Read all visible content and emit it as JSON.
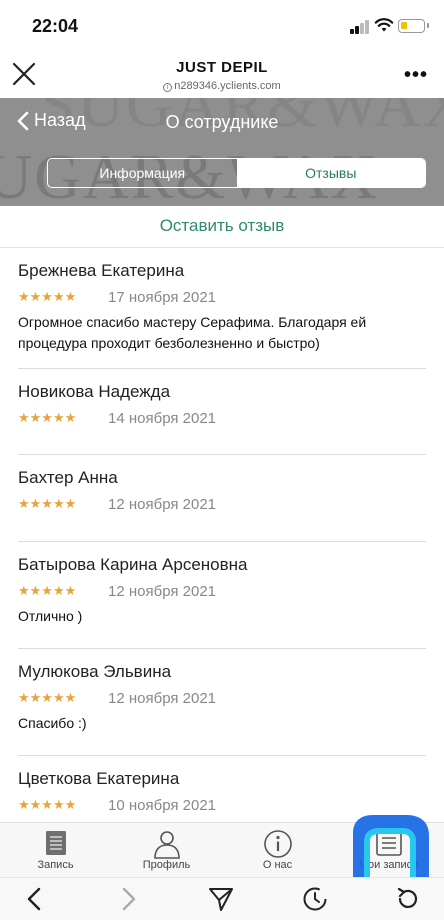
{
  "status": {
    "time": "22:04"
  },
  "browser": {
    "title": "JUST DEPIL",
    "url": "n289346.yclients.com"
  },
  "header": {
    "back_label": "Назад",
    "title": "О сотруднике",
    "tabs": [
      {
        "label": "Информация",
        "active": false
      },
      {
        "label": "Отзывы",
        "active": true
      }
    ]
  },
  "leave_review_label": "Оставить отзыв",
  "reviews": [
    {
      "name": "Брежнева Екатерина",
      "stars": "★★★★★",
      "rating": 5,
      "date": "17 ноября 2021",
      "text": "Огромное спасибо мастеру Серафима. Благодаря ей процедура проходит безболезненно и быстро)"
    },
    {
      "name": "Новикова Надежда",
      "stars": "★★★★★",
      "rating": 5,
      "date": "14 ноября 2021",
      "text": ""
    },
    {
      "name": "Бахтер Анна",
      "stars": "★★★★★",
      "rating": 5,
      "date": "12 ноября 2021",
      "text": ""
    },
    {
      "name": "Батырова Карина Арсеновна",
      "stars": "★★★★★",
      "rating": 5,
      "date": "12 ноября 2021",
      "text": "Отлично )"
    },
    {
      "name": "Мулюкова Эльвина",
      "stars": "★★★★★",
      "rating": 5,
      "date": "12 ноября 2021",
      "text": "Спасибо :)"
    },
    {
      "name": "Цветкова Екатерина",
      "stars": "★★★★★",
      "rating": 5,
      "date": "10 ноября 2021",
      "text": ""
    }
  ],
  "tabbar": {
    "items": [
      {
        "label": "Запись",
        "icon": "document-icon"
      },
      {
        "label": "Профиль",
        "icon": "person-icon"
      },
      {
        "label": "О нас",
        "icon": "info-icon"
      },
      {
        "label": "Мои записи",
        "icon": "list-icon"
      }
    ]
  },
  "colors": {
    "accent": "#2f8a6f",
    "star": "#e8a33c",
    "hero_bg": "#8f8f8f"
  }
}
